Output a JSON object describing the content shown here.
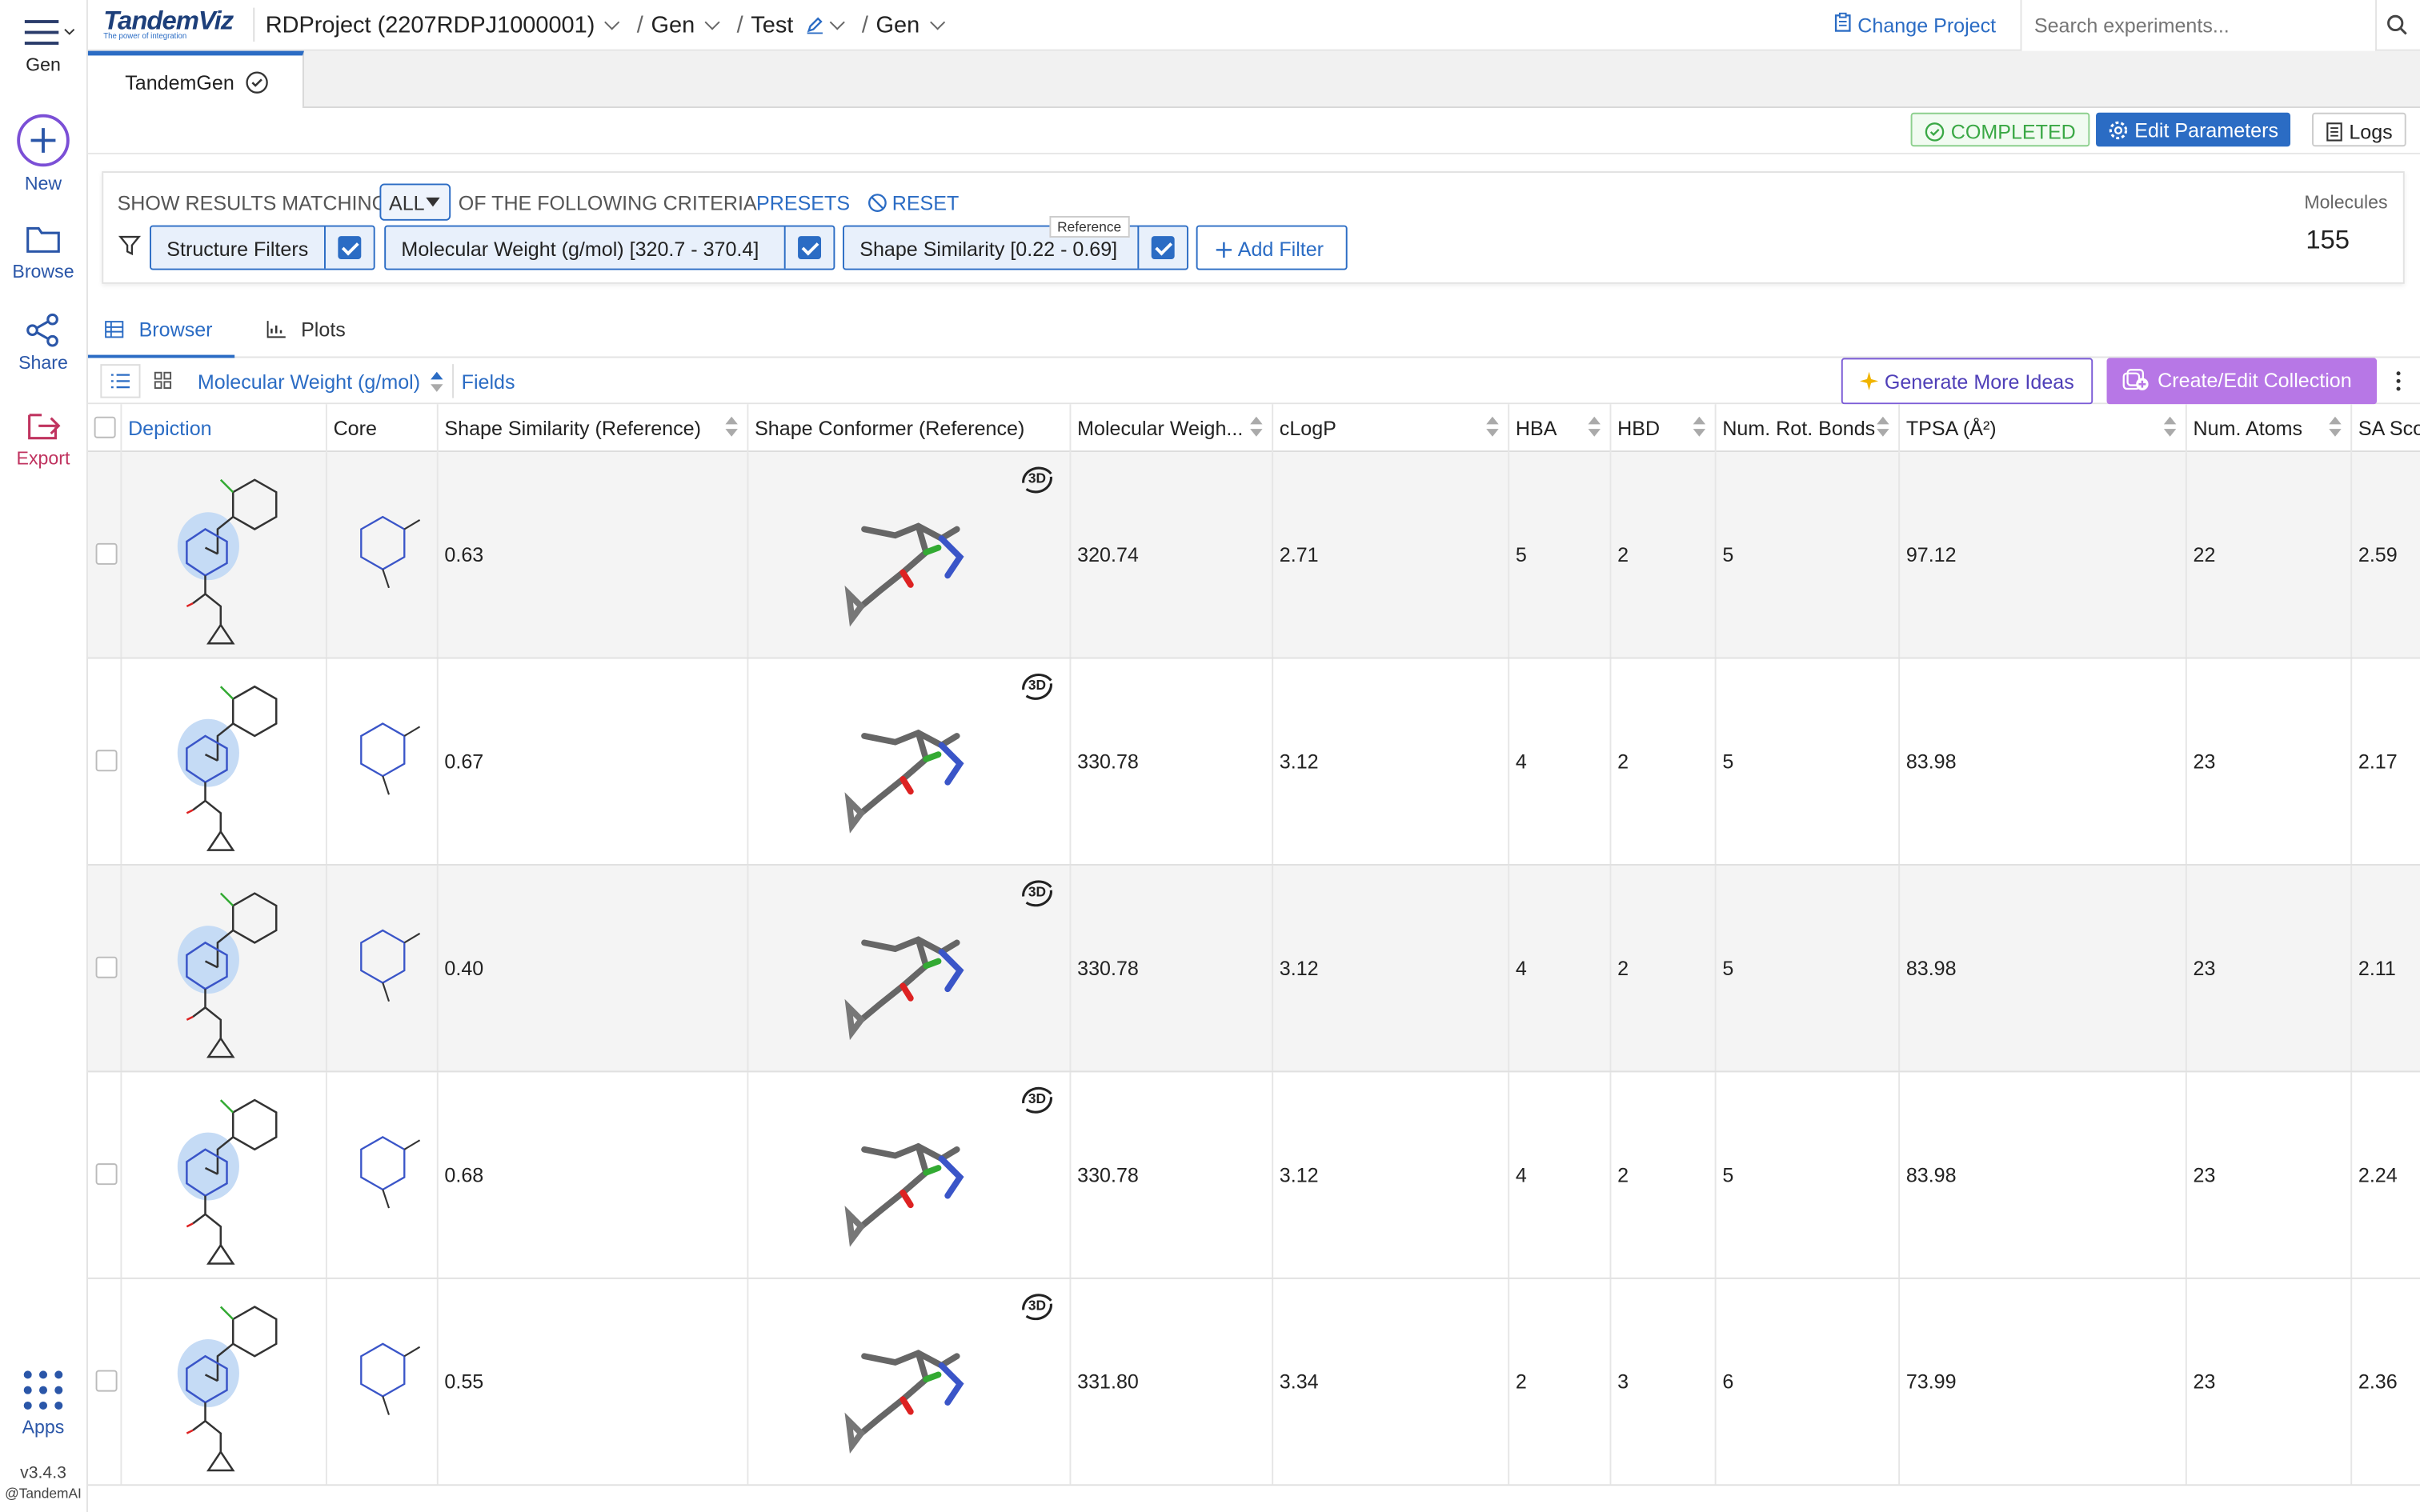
{
  "nav": {
    "menu_label": "Gen",
    "items": [
      {
        "label": "New",
        "icon": "plus-circle-icon"
      },
      {
        "label": "Browse",
        "icon": "folder-icon"
      },
      {
        "label": "Share",
        "icon": "share-icon"
      },
      {
        "label": "Export",
        "icon": "export-icon"
      },
      {
        "label": "Apps",
        "icon": "apps-grid-icon"
      }
    ],
    "version": "v3.4.3",
    "copyright": "@TandemAI"
  },
  "header": {
    "logo_text": "TandemViz",
    "logo_tagline": "The power of integration",
    "breadcrumb": [
      "RDProject (2207RDPJ1000001)",
      "Gen",
      "Test",
      "Gen"
    ],
    "change_project": "Change Project",
    "search_placeholder": "Search experiments..."
  },
  "tab": {
    "label": "TandemGen"
  },
  "status": {
    "completed": "COMPLETED",
    "edit_params": "Edit Parameters",
    "logs": "Logs",
    "colors": {
      "success": "#3aa845",
      "primary": "#2b6cc4",
      "collection": "#b777e6"
    }
  },
  "filters": {
    "show_prefix": "SHOW RESULTS MATCHING",
    "match_mode": "ALL",
    "show_suffix": "OF THE FOLLOWING CRITERIA",
    "presets": "PRESETS",
    "reset": "RESET",
    "chips": [
      {
        "label": "Structure Filters"
      },
      {
        "label": "Molecular Weight (g/mol) [320.7 - 370.4]"
      },
      {
        "label": "Shape Similarity [0.22 - 0.69]",
        "tag": "Reference"
      }
    ],
    "add_filter": "Add Filter",
    "molecules_label": "Molecules",
    "molecules_count": "155"
  },
  "view_tabs": {
    "browser": "Browser",
    "plots": "Plots"
  },
  "toolbar": {
    "sort_field": "Molecular Weight (g/mol)",
    "fields": "Fields",
    "generate": "Generate More Ideas",
    "collection": "Create/Edit Collection"
  },
  "table": {
    "columns": [
      "Depiction",
      "Core",
      "Shape Similarity (Reference)",
      "Shape Conformer (Reference)",
      "Molecular Weigh...",
      "cLogP",
      "HBA",
      "HBD",
      "Num. Rot. Bonds",
      "TPSA (Å²)",
      "Num. Atoms",
      "SA Sco"
    ],
    "badge_3d": "3D",
    "rows": [
      {
        "shape_sim": "0.63",
        "mw": "320.74",
        "clogp": "2.71",
        "hba": "5",
        "hbd": "2",
        "rot": "5",
        "tpsa": "97.12",
        "atoms": "22",
        "sa": "2.59"
      },
      {
        "shape_sim": "0.67",
        "mw": "330.78",
        "clogp": "3.12",
        "hba": "4",
        "hbd": "2",
        "rot": "5",
        "tpsa": "83.98",
        "atoms": "23",
        "sa": "2.17"
      },
      {
        "shape_sim": "0.40",
        "mw": "330.78",
        "clogp": "3.12",
        "hba": "4",
        "hbd": "2",
        "rot": "5",
        "tpsa": "83.98",
        "atoms": "23",
        "sa": "2.11"
      },
      {
        "shape_sim": "0.68",
        "mw": "330.78",
        "clogp": "3.12",
        "hba": "4",
        "hbd": "2",
        "rot": "5",
        "tpsa": "83.98",
        "atoms": "23",
        "sa": "2.24"
      },
      {
        "shape_sim": "0.55",
        "mw": "331.80",
        "clogp": "3.34",
        "hba": "2",
        "hbd": "3",
        "rot": "6",
        "tpsa": "73.99",
        "atoms": "23",
        "sa": "2.36"
      }
    ]
  }
}
